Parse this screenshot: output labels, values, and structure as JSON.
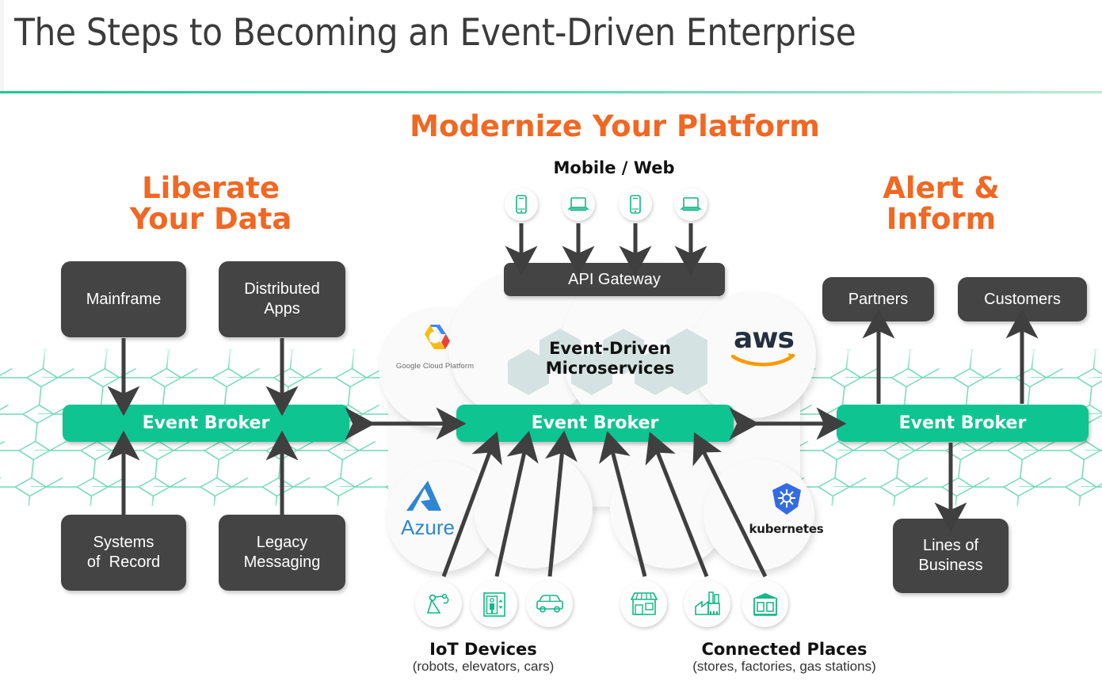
{
  "header": {
    "title": "The Steps to Becoming an Event-Driven Enterprise",
    "rule_color": "#1ec98f"
  },
  "colors": {
    "accent_orange": "#F26722",
    "broker_green": "#0ec592",
    "box_gray": "#444444",
    "mesh_teal": "#6fd9b7",
    "hexagon_gray": "#d5e2e2",
    "icon_green": "#12b886",
    "title_gray": "#3b3b3b"
  },
  "sections": {
    "liberate": {
      "heading": "Liberate\nYour Data"
    },
    "modernize": {
      "heading": "Modernize Your Platform"
    },
    "alert": {
      "heading": "Alert &\nInform"
    }
  },
  "left": {
    "top_boxes": [
      {
        "label": "Mainframe"
      },
      {
        "label": "Distributed\nApps"
      }
    ],
    "broker_label": "Event Broker",
    "bottom_boxes": [
      {
        "label": "Systems\nof  Record"
      },
      {
        "label": "Legacy\nMessaging"
      }
    ]
  },
  "center": {
    "channel_label": "Mobile / Web",
    "channel_icons": [
      {
        "name": "mobile-phone-icon"
      },
      {
        "name": "laptop-icon"
      },
      {
        "name": "mobile-phone-icon"
      },
      {
        "name": "laptop-icon"
      }
    ],
    "api_gateway_label": "API Gateway",
    "microservices_label": "Event-Driven\nMicroservices",
    "broker_label": "Event Broker",
    "cloud_logos": [
      {
        "name": "google-cloud-platform-logo",
        "caption": "Google Cloud Platform"
      },
      {
        "name": "aws-logo",
        "caption": "aws"
      },
      {
        "name": "azure-logo",
        "caption": "Azure"
      },
      {
        "name": "kubernetes-logo",
        "caption": "kubernetes"
      }
    ],
    "iot": {
      "title": "IoT Devices",
      "subtitle": "(robots, elevators, cars)",
      "icons": [
        {
          "name": "robot-arm-icon"
        },
        {
          "name": "elevator-icon"
        },
        {
          "name": "car-icon"
        }
      ]
    },
    "places": {
      "title": "Connected Places",
      "subtitle": "(stores, factories, gas stations)",
      "icons": [
        {
          "name": "store-icon"
        },
        {
          "name": "factory-icon"
        },
        {
          "name": "gas-station-icon"
        }
      ]
    }
  },
  "right": {
    "top_boxes": [
      {
        "label": "Partners"
      },
      {
        "label": "Customers"
      }
    ],
    "broker_label": "Event Broker",
    "bottom_boxes": [
      {
        "label": "Lines of\nBusiness"
      }
    ]
  }
}
